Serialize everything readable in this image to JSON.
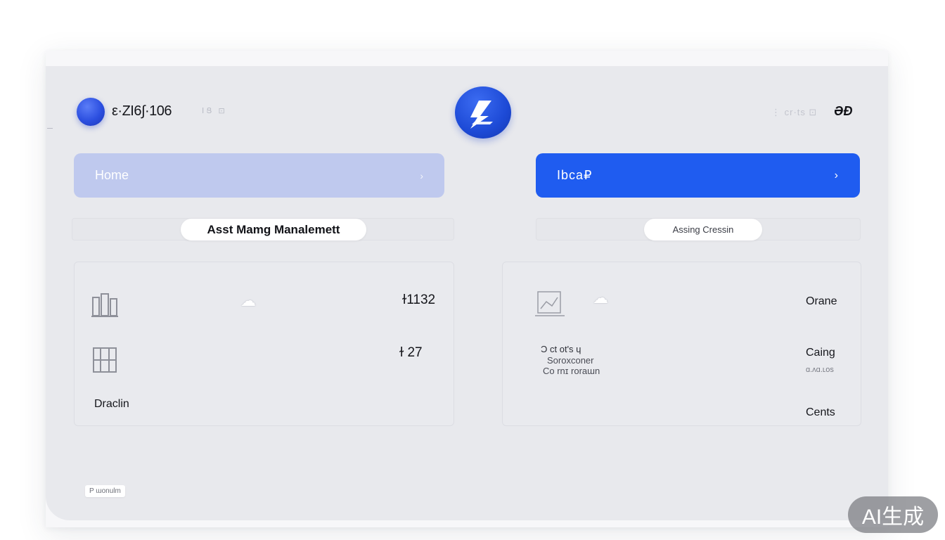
{
  "header": {
    "version_text": "ε·ZI6∫·106",
    "mini_icons": "ⅠՑ ⊡",
    "right_status": "⋮ cr·ts ⊡",
    "brand_mark": "ƏÐ"
  },
  "nav": {
    "home_label": "Home",
    "home_chevron": "›",
    "local_label": "Ibca₽",
    "local_chevron": "›"
  },
  "tabs": {
    "left_label": "Asst Mamg Manalemett",
    "right_label": "Assing Cressin"
  },
  "left_card": {
    "row1_value": "ɫ1132",
    "row2_value": "ɫ 27",
    "footer_label": "Draclin"
  },
  "right_card": {
    "row1_label": "Orane",
    "detail_line1": "Ɔ ct ot's ɥ",
    "detail_line2": "Soroxconer",
    "detail_line3": "Co rnɪ rorаɯn",
    "row2_label": "Caing",
    "row2_sublabel": "ɑ.ʌɑ.ʟos",
    "row3_label": "Cents"
  },
  "footer": {
    "tag_prefix": "P",
    "tag_text": "ɯonulm"
  },
  "watermark": "AI生成",
  "colors": {
    "accent": "#1f5cf0",
    "home_button": "#bfc9ee",
    "avatar": "#2c4fe0",
    "panel_bg": "#e8e9ed"
  },
  "icons": {
    "avatar": "blue-circle-avatar",
    "logo": "blue-bolt-logo",
    "row_glyph": "building-group-icon",
    "cloud": "cloud-icon"
  }
}
